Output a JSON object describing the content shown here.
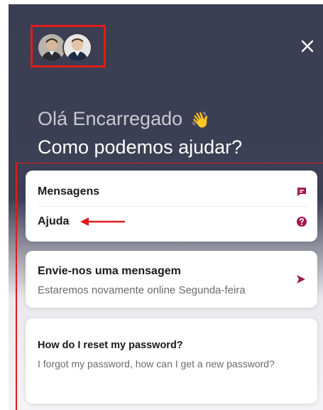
{
  "header": {
    "greeting": "Olá Encarregado",
    "greeting_emoji": "👋",
    "headline": "Como podemos ajudar?",
    "avatars": [
      "team-member-avatar",
      "team-member-avatar"
    ],
    "close_icon": "close-icon"
  },
  "nav": {
    "items": [
      {
        "label": "Mensagens",
        "icon": "chat-icon"
      },
      {
        "label": "Ajuda",
        "icon": "help-icon"
      }
    ]
  },
  "send_message": {
    "title": "Envie-nos uma mensagem",
    "subtitle": "Estaremos novamente online Segunda-feira",
    "icon": "send-icon"
  },
  "article": {
    "title": "How do I reset my password?",
    "body": "I forgot my password, how can I get a new password?"
  },
  "colors": {
    "header_bg": "#3b3e52",
    "accent": "#a3174e",
    "annotation": "#e11b1b"
  }
}
